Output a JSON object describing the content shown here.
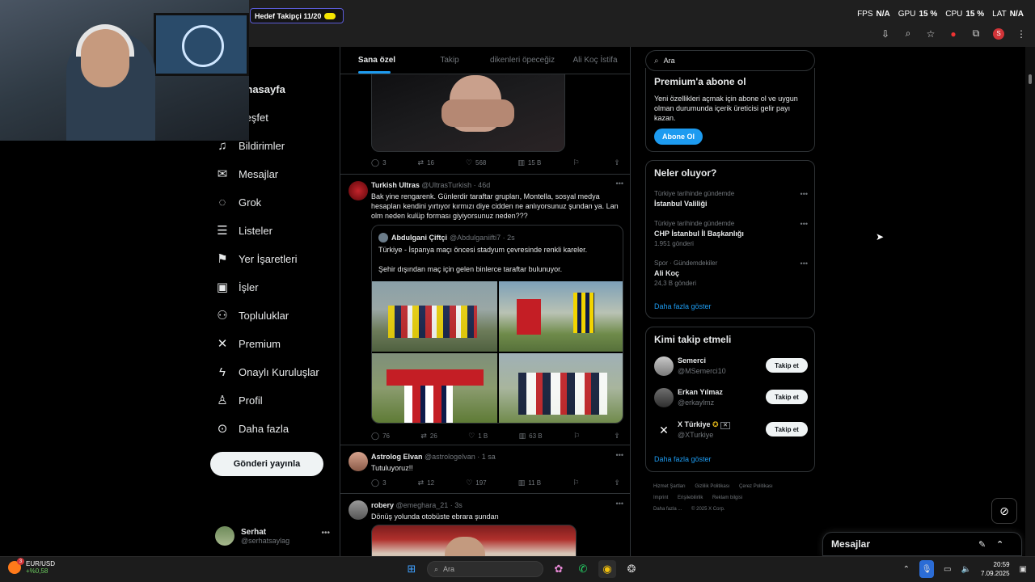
{
  "overlay": {
    "goal_label": "Hedef Takipçi 11/20",
    "stats": [
      {
        "label": "FPS",
        "value": "N/A"
      },
      {
        "label": "GPU",
        "value": "15 %"
      },
      {
        "label": "CPU",
        "value": "15 %"
      },
      {
        "label": "LAT",
        "value": "N/A"
      }
    ]
  },
  "browser_icons": [
    "install-icon",
    "zoom-icon",
    "star-icon",
    "extension-red-icon",
    "puzzle-icon",
    "profile-icon",
    "menu-icon"
  ],
  "browser_profile_initial": "S",
  "nav": {
    "items": [
      {
        "label": "Anasayfa",
        "icon": "home-icon",
        "glyph": "⌂"
      },
      {
        "label": "Keşfet",
        "icon": "search-icon",
        "glyph": "⌕"
      },
      {
        "label": "Bildirimler",
        "icon": "bell-icon",
        "glyph": "🔔"
      },
      {
        "label": "Mesajlar",
        "icon": "mail-icon",
        "glyph": "✉"
      },
      {
        "label": "Grok",
        "icon": "grok-icon",
        "glyph": "◌"
      },
      {
        "label": "Listeler",
        "icon": "list-icon",
        "glyph": "☰"
      },
      {
        "label": "Yer İşaretleri",
        "icon": "bookmark-icon",
        "glyph": "⚑"
      },
      {
        "label": "İşler",
        "icon": "briefcase-icon",
        "glyph": "💼"
      },
      {
        "label": "Topluluklar",
        "icon": "communities-icon",
        "glyph": "👥"
      },
      {
        "label": "Premium",
        "icon": "x-logo-icon",
        "glyph": "X"
      },
      {
        "label": "Onaylı Kuruluşlar",
        "icon": "lightning-icon",
        "glyph": "⚡"
      },
      {
        "label": "Profil",
        "icon": "user-icon",
        "glyph": "👤"
      },
      {
        "label": "Daha fazla",
        "icon": "more-circle-icon",
        "glyph": "⋯"
      }
    ],
    "post_button": "Gönderi yayınla",
    "user": {
      "name": "Serhat",
      "handle": "@serhatsaylag"
    }
  },
  "timeline": {
    "tabs": [
      "Sana özel",
      "Takip",
      "dikenleri öpeceğiz",
      "Ali Koç İstifa"
    ],
    "first_actions": {
      "replies": "3",
      "reposts": "16",
      "likes": "568",
      "views": "15 B"
    },
    "tweet1": {
      "name": "Turkish Ultras",
      "handle": "@UltrasTurkish · 46d",
      "text": "Bak yine rengarenk. Günlerdir taraftar grupları, Montella, sosyal medya hesapları kendini yırtıyor kırmızı diye cidden ne anlıyorsunuz şundan ya. Lan olm neden kulüp forması giyiyorsunuz neden???",
      "quote": {
        "name": "Abdulgani Çiftçi",
        "handle": "@Abdulganiifti7 · 2s",
        "line1": "Türkiye - İspanya maçı öncesi stadyum çevresinde renkli kareler.",
        "line2": "Şehir dışından maç için gelen binlerce taraftar bulunuyor."
      },
      "actions": {
        "replies": "76",
        "reposts": "26",
        "likes": "1 B",
        "views": "63 B"
      }
    },
    "tweet2": {
      "name": "Astrolog Elvan",
      "handle": "@astrologelvan · 1 sa",
      "text": "Tutuluyoruz!!",
      "actions": {
        "replies": "3",
        "reposts": "12",
        "likes": "197",
        "views": "11 B"
      }
    },
    "tweet3": {
      "name": "robery",
      "handle": "@emeghara_21 · 3s",
      "text": "Dönüş yolunda otobüste ebrara şundan"
    }
  },
  "right": {
    "search_placeholder": "Ara",
    "premium": {
      "title": "Premium'a abone ol",
      "text": "Yeni özellikleri açmak için abone ol ve uygun olman durumunda içerik üreticisi gelir payı kazan.",
      "button": "Abone Ol"
    },
    "trends": {
      "title": "Neler oluyor?",
      "items": [
        {
          "context": "Türkiye tarihinde gündemde",
          "title": "İstanbul Valiliği",
          "count": ""
        },
        {
          "context": "Türkiye tarihinde gündemde",
          "title": "CHP İstanbul İl Başkanlığı",
          "count": "1.951 gönderi"
        },
        {
          "context": "Spor · Gündemdekiler",
          "title": "Ali Koç",
          "count": "24,3 B gönderi"
        }
      ],
      "show_more": "Daha fazla göster"
    },
    "who_to_follow": {
      "title": "Kimi takip etmeli",
      "items": [
        {
          "name": "Semerci",
          "handle": "@MSemerci10",
          "button": "Takip et"
        },
        {
          "name": "Erkan Yılmaz",
          "handle": "@erkaylmz",
          "button": "Takip et"
        },
        {
          "name": "X Türkiye",
          "handle": "@XTurkiye",
          "button": "Takip et"
        }
      ],
      "show_more": "Daha fazla göster"
    },
    "footer": [
      "Hizmet Şartları",
      "Gizlilik Politikası",
      "Çerez Politikası",
      "Imprint",
      "Erişilebilirlik",
      "Reklam bilgisi",
      "Daha fazla ...",
      "© 2025 X Corp."
    ]
  },
  "dm_drawer": {
    "title": "Mesajlar"
  },
  "taskbar": {
    "ticker_pair": "EUR/USD",
    "ticker_change": "+%0,58",
    "ticker_badge": "3",
    "search": "Ara",
    "time": "20:59",
    "date": "7.09.2025"
  }
}
